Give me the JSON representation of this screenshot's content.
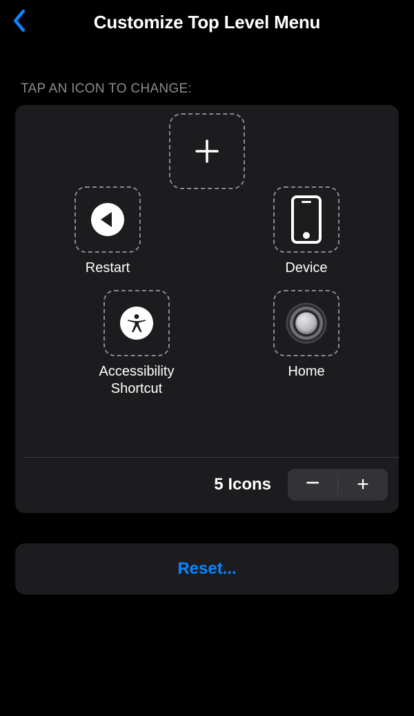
{
  "header": {
    "back_icon": "chevron-left",
    "title": "Customize Top Level Menu"
  },
  "section_label": "TAP AN ICON TO CHANGE:",
  "slots": {
    "top_center": {
      "label": "",
      "icon": "plus"
    },
    "mid_left": {
      "label": "Restart",
      "icon": "restart"
    },
    "mid_right": {
      "label": "Device",
      "icon": "device"
    },
    "bot_left": {
      "label": "Accessibility Shortcut",
      "icon": "accessibility"
    },
    "bot_right": {
      "label": "Home",
      "icon": "home"
    }
  },
  "icon_count": {
    "label": "5 Icons",
    "value": 5,
    "minus": "−",
    "plus": "+"
  },
  "reset_label": "Reset...",
  "colors": {
    "accent": "#0a84ff",
    "background": "#000000",
    "card": "#1c1c1e",
    "secondary_text": "#8d8d93"
  }
}
